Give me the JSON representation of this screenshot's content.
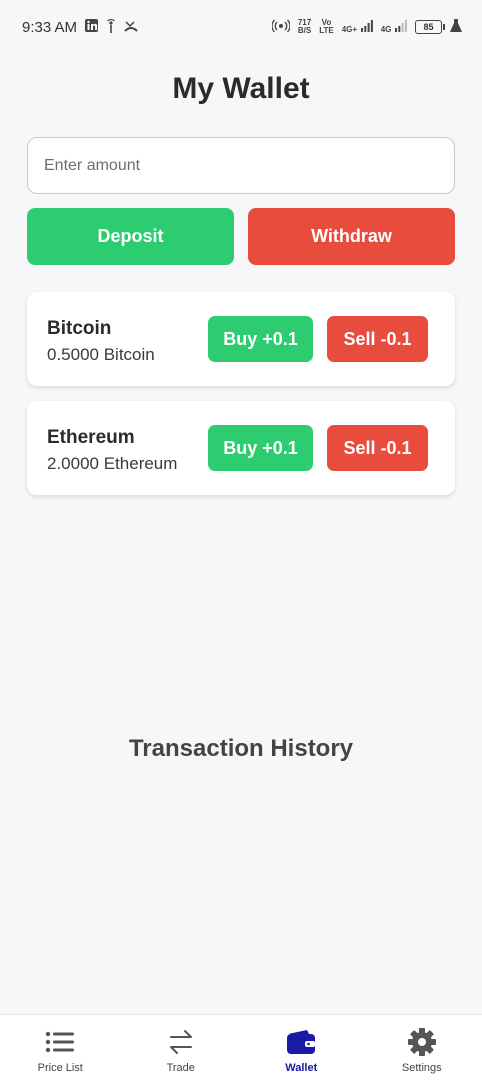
{
  "status_bar": {
    "time": "9:33 AM",
    "left_icons": [
      "linkedin-icon",
      "wifi-calling-icon",
      "missed-call-icon"
    ],
    "speed_value": "717",
    "speed_unit": "B/S",
    "volte": "Vo",
    "volte2": "LTE",
    "net1": "4G+",
    "net2": "4G",
    "battery": "85"
  },
  "header": {
    "title": "My Wallet"
  },
  "amount_input": {
    "placeholder": "Enter amount",
    "value": ""
  },
  "actions": {
    "deposit_label": "Deposit",
    "withdraw_label": "Withdraw"
  },
  "assets": [
    {
      "name": "Bitcoin",
      "balance": "0.5000 Bitcoin",
      "buy_label": "Buy +0.1",
      "sell_label": "Sell -0.1"
    },
    {
      "name": "Ethereum",
      "balance": "2.0000 Ethereum",
      "buy_label": "Buy +0.1",
      "sell_label": "Sell -0.1"
    }
  ],
  "history": {
    "title": "Transaction History"
  },
  "bottom_nav": {
    "items": [
      {
        "label": "Price List",
        "icon": "list-icon"
      },
      {
        "label": "Trade",
        "icon": "swap-arrows-icon"
      },
      {
        "label": "Wallet",
        "icon": "wallet-icon",
        "active": true
      },
      {
        "label": "Settings",
        "icon": "gear-icon"
      }
    ]
  },
  "colors": {
    "green": "#2ecc71",
    "red": "#e74c3c",
    "active_nav": "#1a1aa6",
    "background": "#f6f7f9"
  }
}
